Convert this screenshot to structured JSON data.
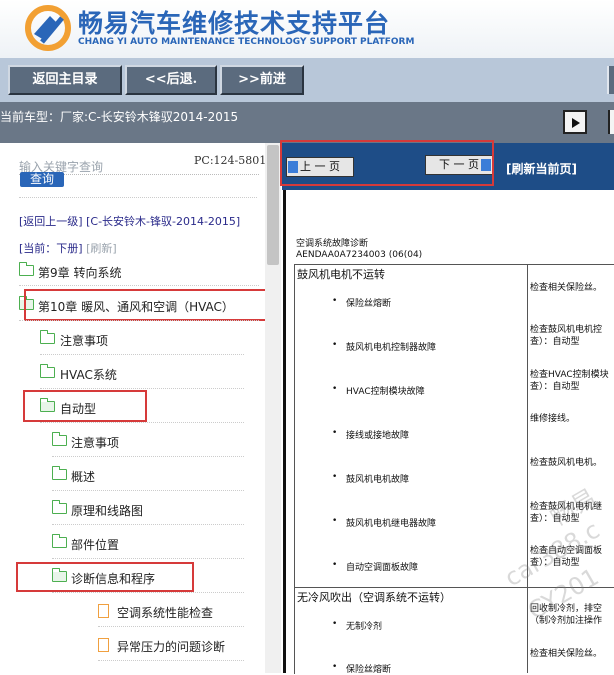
{
  "header": {
    "title_cn": "畅易汽车维修技术支持平台",
    "title_en": "CHANG YI AUTO MAINTENANCE TECHNOLOGY SUPPORT PLATFORM"
  },
  "toolbar": {
    "home": "返回主目录",
    "back": "<<后退.",
    "forward": ">>前进"
  },
  "vehicle": {
    "label": "当前车型：",
    "maker": "厂家:C-长安铃木锋驭2014-2015"
  },
  "sidebar": {
    "search_placeholder": "输入关键字查询",
    "search_button": "查询",
    "pc_code": "PC:124-5801",
    "back_up": "[返回上一级]",
    "back_path": "[C-长安铃木-锋驭-2014-2015]",
    "current_label": "[当前：下册]",
    "refresh": "[刷新]",
    "tree": [
      {
        "label": "第9章 转向系统",
        "type": "folder"
      },
      {
        "label": "第10章 暖风、通风和空调（HVAC）",
        "type": "folder-open"
      },
      {
        "label": "注意事项",
        "type": "folder"
      },
      {
        "label": "HVAC系统",
        "type": "folder"
      },
      {
        "label": "自动型",
        "type": "folder-open"
      },
      {
        "label": "注意事项",
        "type": "folder"
      },
      {
        "label": "概述",
        "type": "folder"
      },
      {
        "label": "原理和线路图",
        "type": "folder"
      },
      {
        "label": "部件位置",
        "type": "folder"
      },
      {
        "label": "诊断信息和程序",
        "type": "folder-open"
      },
      {
        "label": "空调系统性能检查",
        "type": "doc"
      },
      {
        "label": "异常压力的问题诊断",
        "type": "doc"
      }
    ]
  },
  "content": {
    "prev_page": "上 一 页",
    "next_page": "下 一 页",
    "refresh_page": "[刷新当前页]",
    "doc_title": "空调系统故障诊断",
    "doc_code": "AENDAA0A7234003 (06(04)",
    "sections": [
      {
        "title": "鼓风机电机不运转",
        "rows": [
          {
            "cause": "保险丝熔断",
            "action": "检查相关保险丝。"
          },
          {
            "cause": "鼓风机电机控制器故障",
            "action": "检查鼓风机电机控\n查）：自动型"
          },
          {
            "cause": "HVAC控制模块故障",
            "action": "检查HVAC控制模块\n查）：自动型"
          },
          {
            "cause": "接线或接地故障",
            "action": "维修接线。"
          },
          {
            "cause": "鼓风机电机故障",
            "action": "检查鼓风机电机。"
          },
          {
            "cause": "鼓风机电机继电器故障",
            "action": "检查鼓风机电机继\n查）：自动型"
          },
          {
            "cause": "自动空调面板故障",
            "action": "检查自动空调面板\n查）：自动型"
          }
        ]
      },
      {
        "title": "无冷风吹出（空调系统不运转）",
        "rows": [
          {
            "cause": "无制冷剂",
            "action": "回收制冷剂，排空\n（制冷剂加注操作"
          },
          {
            "cause": "保险丝熔断",
            "action": "检查相关保险丝。"
          }
        ]
      }
    ],
    "watermark_1": "畅易",
    "watermark_2": "car388.c",
    "watermark_3": "CY201"
  },
  "colors": {
    "brand_blue": "#2a66b8",
    "toolbar_bg": "#b8c7d9",
    "vehicle_bar": "#6a7787",
    "nav_bar": "#1e4d87",
    "highlight_red": "#d63a3a"
  }
}
